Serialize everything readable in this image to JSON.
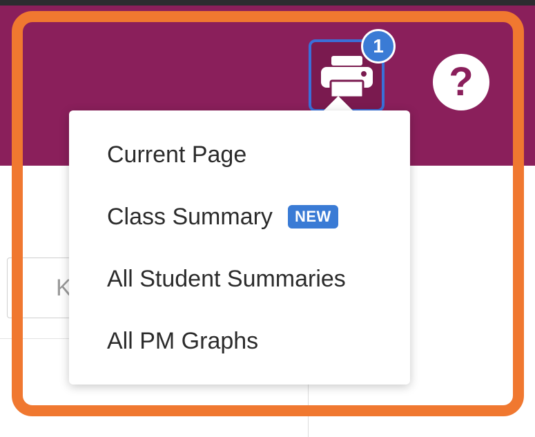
{
  "header": {
    "print_badge_count": "1",
    "help_label": "?"
  },
  "search": {
    "placeholder": "K"
  },
  "print_menu": {
    "items": [
      {
        "label": "Current Page"
      },
      {
        "label": "Class Summary",
        "badge": "NEW"
      },
      {
        "label": "All Student Summaries"
      },
      {
        "label": "All PM Graphs"
      }
    ]
  },
  "colors": {
    "header_bg": "#8a1f5b",
    "highlight": "#f07830",
    "badge_bg": "#3a7bd5",
    "focus_ring": "#3a6fd8"
  },
  "icons": {
    "print": "printer-icon",
    "help": "question-mark-icon"
  }
}
